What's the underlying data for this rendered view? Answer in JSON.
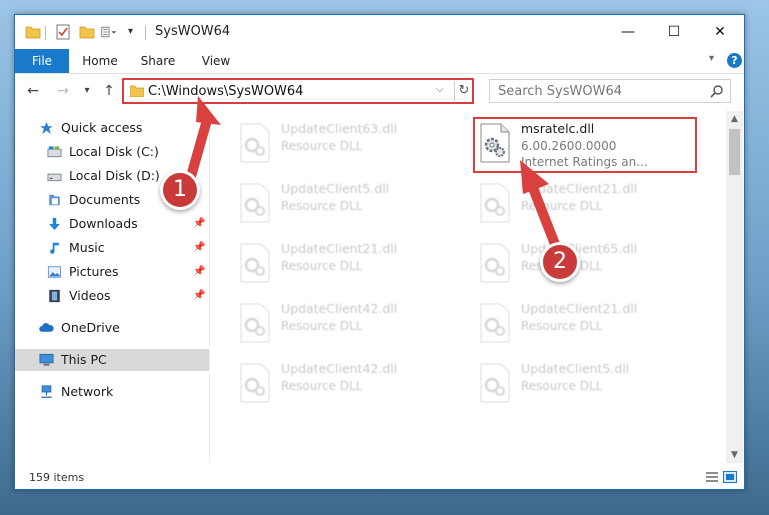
{
  "window": {
    "title": "SysWOW64",
    "controls": {
      "minimize": "—",
      "maximize": "☐",
      "close": "✕"
    }
  },
  "ribbon": {
    "tabs": [
      {
        "label": "File"
      },
      {
        "label": "Home"
      },
      {
        "label": "Share"
      },
      {
        "label": "View"
      }
    ],
    "help": "?"
  },
  "address_bar": {
    "path": "C:\\Windows\\SysWOW64",
    "refresh_icon": "refresh-icon"
  },
  "search": {
    "placeholder": "Search SysWOW64"
  },
  "nav_pane": {
    "items": [
      {
        "label": "Quick access",
        "icon": "star-icon"
      },
      {
        "label": "Local Disk (C:)",
        "icon": "drive-icon"
      },
      {
        "label": "Local Disk (D:)",
        "icon": "drive-icon"
      },
      {
        "label": "Documents",
        "icon": "documents-icon"
      },
      {
        "label": "Downloads",
        "icon": "downloads-icon",
        "pinned": true
      },
      {
        "label": "Music",
        "icon": "music-icon",
        "pinned": true
      },
      {
        "label": "Pictures",
        "icon": "pictures-icon",
        "pinned": true
      },
      {
        "label": "Videos",
        "icon": "videos-icon",
        "pinned": true
      },
      {
        "label": "OneDrive",
        "icon": "onedrive-icon"
      },
      {
        "label": "This PC",
        "icon": "pc-icon",
        "selected": true
      },
      {
        "label": "Network",
        "icon": "network-icon"
      }
    ]
  },
  "files": [
    {
      "name": "UpdateClient63.dll",
      "desc": "Resource DLL",
      "ghost": true
    },
    {
      "name": "msratelc.dll",
      "version": "6.00.2600.0000",
      "desc": "Internet Ratings an...",
      "highlighted": true
    },
    {
      "name": "UpdateClient5.dll",
      "desc": "Resource DLL",
      "ghost": true
    },
    {
      "name": "UpdateClient21.dll",
      "desc": "Resource DLL",
      "ghost": true
    },
    {
      "name": "UpdateClient21.dll",
      "desc": "Resource DLL",
      "ghost": true
    },
    {
      "name": "UpdateClient65.dll",
      "desc": "Resource DLL",
      "ghost": true
    },
    {
      "name": "UpdateClient42.dll",
      "desc": "Resource DLL",
      "ghost": true
    },
    {
      "name": "UpdateClient21.dll",
      "desc": "Resource DLL",
      "ghost": true
    },
    {
      "name": "UpdateClient42.dll",
      "desc": "Resource DLL",
      "ghost": true
    },
    {
      "name": "UpdateClient5.dll",
      "desc": "Resource DLL",
      "ghost": true
    }
  ],
  "status": {
    "item_count": "159 items"
  },
  "annotations": [
    {
      "number": "1"
    },
    {
      "number": "2"
    }
  ],
  "colors": {
    "accent": "#1979ca",
    "highlight_red": "#d83e3e",
    "arrow_red": "#d9413f",
    "selected_bg": "#d9d9d9"
  }
}
